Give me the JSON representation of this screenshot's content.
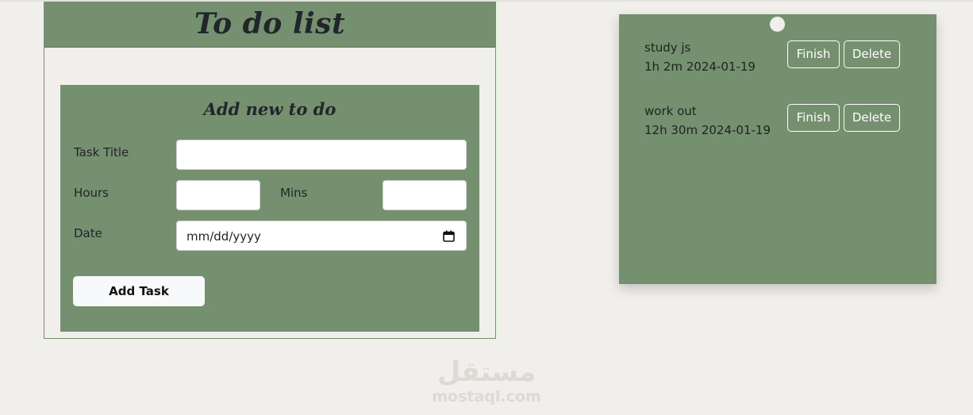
{
  "app": {
    "title": "To do list"
  },
  "form": {
    "heading": "Add new to do",
    "task_title_label": "Task Title",
    "task_title_value": "",
    "hours_label": "Hours",
    "hours_value": "",
    "mins_label": "Mins",
    "mins_value": "",
    "date_label": "Date",
    "date_placeholder": "mm/dd/yyyy",
    "add_button_label": "Add Task"
  },
  "tasks": [
    {
      "title": "study js",
      "meta": "1h 2m 2024-01-19",
      "finish_label": "Finish",
      "delete_label": "Delete"
    },
    {
      "title": "work out",
      "meta": "12h 30m 2024-01-19",
      "finish_label": "Finish",
      "delete_label": "Delete"
    }
  ],
  "watermark": {
    "arabic": "مستقل",
    "latin": "mostaql.com"
  },
  "colors": {
    "accent_green": "#74906f",
    "background": "#f1efeb",
    "title_text": "#22262a"
  },
  "icons": {
    "date_picker": "calendar-icon",
    "pin": "pin-dot"
  }
}
